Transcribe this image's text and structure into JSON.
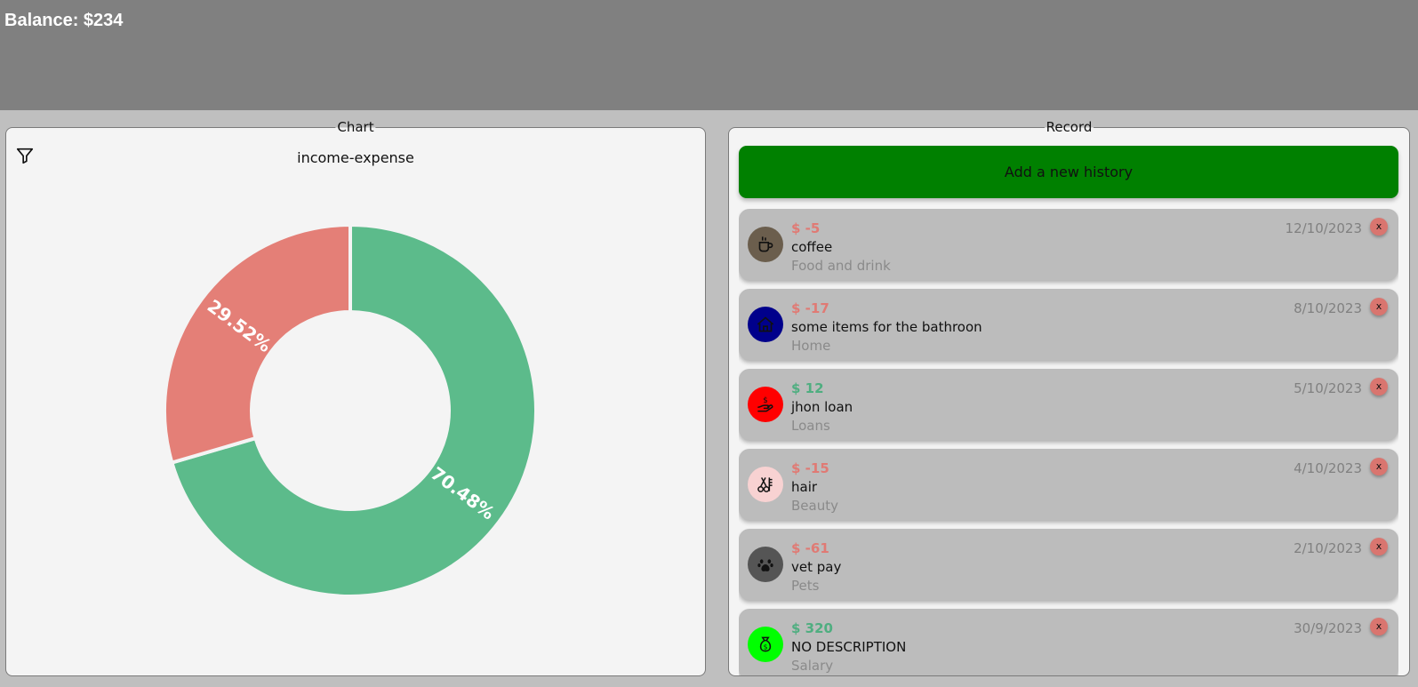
{
  "header": {
    "balance": "Balance: $234"
  },
  "chart_panel": {
    "legend": "Chart",
    "filter_icon": "filter-icon",
    "title": "income-expense"
  },
  "chart_data": {
    "type": "pie",
    "title": "income-expense",
    "slices": [
      {
        "label": "70.48%",
        "value": 70.48,
        "color": "#5cbb8b"
      },
      {
        "label": "29.52%",
        "value": 29.52,
        "color": "#e47f77"
      }
    ]
  },
  "record_panel": {
    "legend": "Record",
    "add_button": "Add a new history",
    "delete_label": "x",
    "records": [
      {
        "amount": "$ -5",
        "date": "12/10/2023",
        "description": "coffee",
        "category": "Food and drink",
        "icon": "coffee-icon",
        "icon_bg": "#6b5e4d",
        "amount_color": "#e07a74"
      },
      {
        "amount": "$ -17",
        "date": "8/10/2023",
        "description": "some items for the bathroon",
        "category": "Home",
        "icon": "home-icon",
        "icon_bg": "#00008b",
        "amount_color": "#e07a74"
      },
      {
        "amount": "$ 12",
        "date": "5/10/2023",
        "description": "jhon loan",
        "category": "Loans",
        "icon": "loan-icon",
        "icon_bg": "#ff0000",
        "amount_color": "#4fae80"
      },
      {
        "amount": "$ -15",
        "date": "4/10/2023",
        "description": "hair",
        "category": "Beauty",
        "icon": "scissors-icon",
        "icon_bg": "#f8d2d2",
        "amount_color": "#e07a74"
      },
      {
        "amount": "$ -61",
        "date": "2/10/2023",
        "description": "vet pay",
        "category": "Pets",
        "icon": "paw-icon",
        "icon_bg": "#555555",
        "amount_color": "#e07a74"
      },
      {
        "amount": "$ 320",
        "date": "30/9/2023",
        "description": "NO DESCRIPTION",
        "category": "Salary",
        "icon": "money-bag-icon",
        "icon_bg": "#00ff00",
        "amount_color": "#4fae80"
      }
    ]
  }
}
